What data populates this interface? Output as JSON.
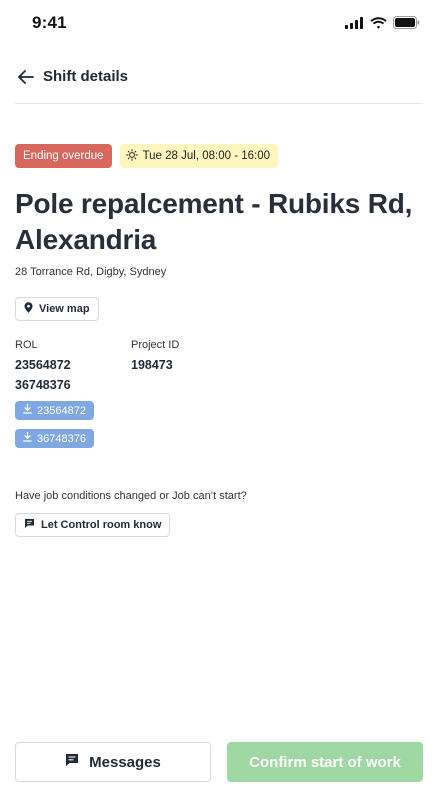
{
  "status_bar": {
    "time": "9:41",
    "icons": [
      "cellular-signal-icon",
      "wifi-icon",
      "battery-icon"
    ]
  },
  "header": {
    "back_icon": "arrow-left-icon",
    "title": "Shift details"
  },
  "badges": {
    "status": "Ending overdue",
    "status_color": "#d8685e",
    "time_icon": "sun-icon",
    "time": "Tue 28 Jul, 08:00 - 16:00",
    "time_bg_color": "#fdf7bf"
  },
  "job": {
    "title": "Pole repalcement - Rubiks Rd, Alexandria",
    "address": "28 Torrance Rd, Digby, Sydney"
  },
  "view_map": {
    "icon": "map-pin-icon",
    "label": "View map"
  },
  "rol": {
    "label": "ROL",
    "values": [
      "23564872",
      "36748376"
    ]
  },
  "project": {
    "label": "Project ID",
    "value": "198473"
  },
  "downloads": [
    {
      "icon": "download-icon",
      "label": "23564872"
    },
    {
      "icon": "download-icon",
      "label": "36748376"
    }
  ],
  "conditions": {
    "question": "Have job conditions changed or Job can’t start?",
    "button_icon": "message-square-icon",
    "button_label": "Let Control room know"
  },
  "footer": {
    "messages_icon": "message-square-icon",
    "messages_label": "Messages",
    "confirm_label": "Confirm start of work",
    "confirm_color": "#9fd8a2"
  }
}
